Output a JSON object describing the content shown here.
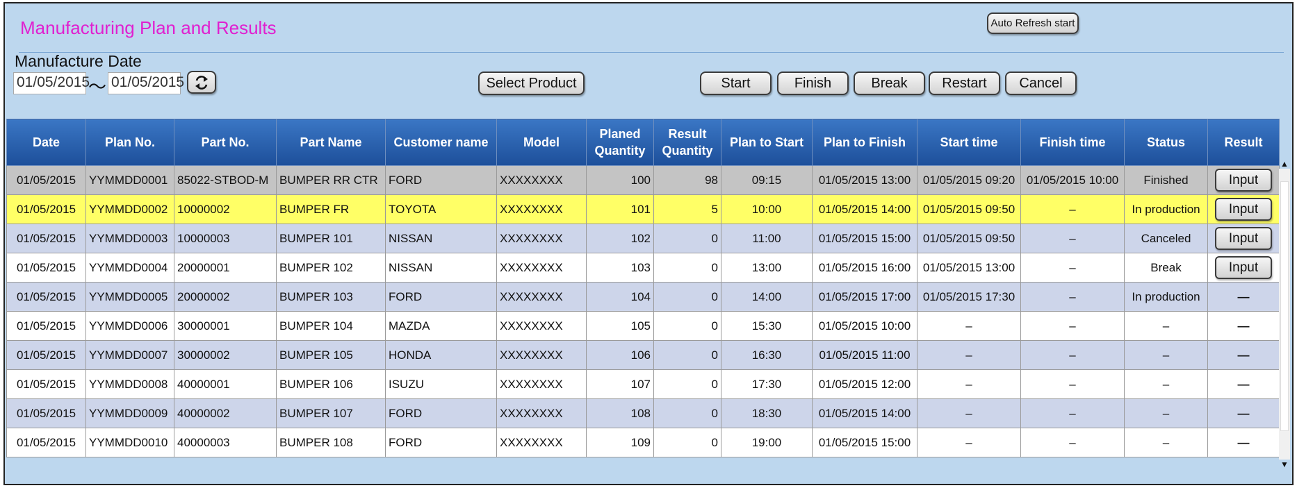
{
  "header": {
    "title": "Manufacturing Plan and Results",
    "auto_refresh_label": "Auto Refresh start"
  },
  "filter": {
    "date_label": "Manufacture Date",
    "date_from": "01/05/2015",
    "separator": "～",
    "date_to": "01/05/2015",
    "refresh_icon": "refresh-icon",
    "select_product_label": "Select Product"
  },
  "actions": {
    "start": "Start",
    "finish": "Finish",
    "break": "Break",
    "restart": "Restart",
    "cancel": "Cancel"
  },
  "table": {
    "columns": [
      "Date",
      "Plan No.",
      "Part No.",
      "Part Name",
      "Customer name",
      "Model",
      "Planed Quantity",
      "Result Quantity",
      "Plan to Start",
      "Plan to Finish",
      "Start time",
      "Finish time",
      "Status",
      "Result"
    ],
    "rows": [
      {
        "date": "01/05/2015",
        "plan_no": "YYMMDD0001",
        "part_no": "85022-STBOD-M",
        "part_name": "BUMPER RR CTR",
        "customer": "FORD",
        "model": "XXXXXXXX",
        "planned": "100",
        "result_qty": "98",
        "plan_start": "09:15",
        "plan_finish": "01/05/2015 13:00",
        "start_time": "01/05/2015 09:20",
        "finish_time": "01/05/2015 10:00",
        "status": "Finished",
        "result": "Input"
      },
      {
        "date": "01/05/2015",
        "plan_no": "YYMMDD0002",
        "part_no": "10000002",
        "part_name": "BUMPER FR",
        "customer": "TOYOTA",
        "model": "XXXXXXXX",
        "planned": "101",
        "result_qty": "5",
        "plan_start": "10:00",
        "plan_finish": "01/05/2015 14:00",
        "start_time": "01/05/2015 09:50",
        "finish_time": "–",
        "status": "In production",
        "result": "Input"
      },
      {
        "date": "01/05/2015",
        "plan_no": "YYMMDD0003",
        "part_no": "10000003",
        "part_name": "BUMPER 101",
        "customer": "NISSAN",
        "model": "XXXXXXXX",
        "planned": "102",
        "result_qty": "0",
        "plan_start": "11:00",
        "plan_finish": "01/05/2015 15:00",
        "start_time": "01/05/2015 09:50",
        "finish_time": "–",
        "status": "Canceled",
        "result": "Input"
      },
      {
        "date": "01/05/2015",
        "plan_no": "YYMMDD0004",
        "part_no": "20000001",
        "part_name": "BUMPER 102",
        "customer": "NISSAN",
        "model": "XXXXXXXX",
        "planned": "103",
        "result_qty": "0",
        "plan_start": "13:00",
        "plan_finish": "01/05/2015 16:00",
        "start_time": "01/05/2015 13:00",
        "finish_time": "–",
        "status": "Break",
        "result": "Input"
      },
      {
        "date": "01/05/2015",
        "plan_no": "YYMMDD0005",
        "part_no": "20000002",
        "part_name": "BUMPER 103",
        "customer": "FORD",
        "model": "XXXXXXXX",
        "planned": "104",
        "result_qty": "0",
        "plan_start": "14:00",
        "plan_finish": "01/05/2015 17:00",
        "start_time": "01/05/2015 17:30",
        "finish_time": "–",
        "status": "In production",
        "result": "—"
      },
      {
        "date": "01/05/2015",
        "plan_no": "YYMMDD0006",
        "part_no": "30000001",
        "part_name": "BUMPER 104",
        "customer": "MAZDA",
        "model": "XXXXXXXX",
        "planned": "105",
        "result_qty": "0",
        "plan_start": "15:30",
        "plan_finish": "01/05/2015 10:00",
        "start_time": "–",
        "finish_time": "–",
        "status": "–",
        "result": "—"
      },
      {
        "date": "01/05/2015",
        "plan_no": "YYMMDD0007",
        "part_no": "30000002",
        "part_name": "BUMPER 105",
        "customer": "HONDA",
        "model": "XXXXXXXX",
        "planned": "106",
        "result_qty": "0",
        "plan_start": "16:30",
        "plan_finish": "01/05/2015 11:00",
        "start_time": "–",
        "finish_time": "–",
        "status": "–",
        "result": "—"
      },
      {
        "date": "01/05/2015",
        "plan_no": "YYMMDD0008",
        "part_no": "40000001",
        "part_name": "BUMPER 106",
        "customer": "ISUZU",
        "model": "XXXXXXXX",
        "planned": "107",
        "result_qty": "0",
        "plan_start": "17:30",
        "plan_finish": "01/05/2015 12:00",
        "start_time": "–",
        "finish_time": "–",
        "status": "–",
        "result": "—"
      },
      {
        "date": "01/05/2015",
        "plan_no": "YYMMDD0009",
        "part_no": "40000002",
        "part_name": "BUMPER 107",
        "customer": "FORD",
        "model": "XXXXXXXX",
        "planned": "108",
        "result_qty": "0",
        "plan_start": "18:30",
        "plan_finish": "01/05/2015 14:00",
        "start_time": "–",
        "finish_time": "–",
        "status": "–",
        "result": "—"
      },
      {
        "date": "01/05/2015",
        "plan_no": "YYMMDD0010",
        "part_no": "40000003",
        "part_name": "BUMPER 108",
        "customer": "FORD",
        "model": "XXXXXXXX",
        "planned": "109",
        "result_qty": "0",
        "plan_start": "19:00",
        "plan_finish": "01/05/2015 15:00",
        "start_time": "–",
        "finish_time": "–",
        "status": "–",
        "result": "—"
      }
    ]
  },
  "colors": {
    "title": "#e020d0",
    "header_bg": "#1d4f9a",
    "row_finished": "#c4c4c4",
    "row_selected": "#ffff66",
    "row_alt": "#cdd5ea",
    "status_in_production": "#16a822",
    "status_canceled": "#e21010",
    "status_break": "#1478c8"
  }
}
